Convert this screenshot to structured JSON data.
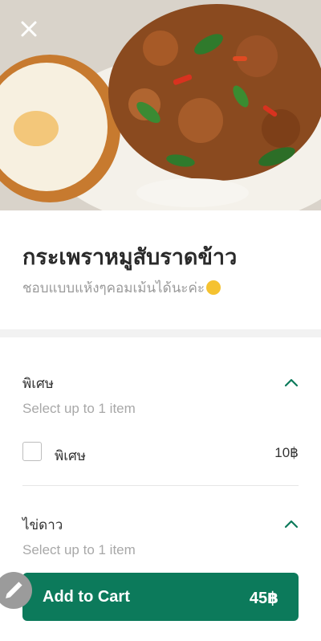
{
  "item": {
    "title": "กระเพราหมูสับราดข้าว",
    "description": "ชอบแบบแห้งๆคอมเม้นได้นะค่ะ"
  },
  "sections": [
    {
      "title": "พิเศษ",
      "subtitle": "Select up to 1 item",
      "options": [
        {
          "label": "พิเศษ",
          "price": "10฿"
        }
      ]
    },
    {
      "title": "ไข่ดาว",
      "subtitle": "Select up to 1 item"
    }
  ],
  "cart": {
    "label": "Add to Cart",
    "price": "45฿"
  },
  "colors": {
    "accent": "#0c7a5b"
  },
  "icons": {
    "close": "close-icon",
    "expand": "chevron-up-icon",
    "edit": "pencil-icon",
    "emoji": "smiling-face-icon"
  }
}
